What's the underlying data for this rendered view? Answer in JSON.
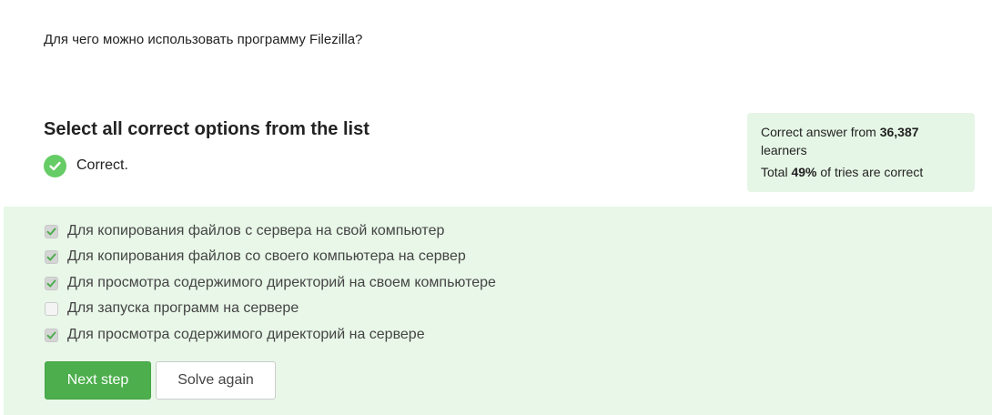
{
  "question": {
    "text": "Для чего можно использовать программу Filezilla?"
  },
  "instruction": {
    "text": "Select all correct options from the list"
  },
  "status": {
    "text": "Correct.",
    "color": "#66cc66"
  },
  "stats": {
    "prefix": "Correct answer from ",
    "learners_count": "36,387",
    "learners_suffix": " learners",
    "total_prefix": "Total ",
    "percent": "49%",
    "total_suffix": " of tries are correct"
  },
  "options": [
    {
      "label": "Для копирования файлов с сервера на свой компьютер",
      "checked": true
    },
    {
      "label": "Для копирования файлов со своего компьютера на сервер",
      "checked": true
    },
    {
      "label": "Для просмотра содержимого директорий на своем компьютере",
      "checked": true
    },
    {
      "label": "Для запуска программ на сервере",
      "checked": false
    },
    {
      "label": "Для просмотра содержимого директорий на сервере",
      "checked": true
    }
  ],
  "buttons": {
    "next": "Next step",
    "solve_again": "Solve again"
  },
  "colors": {
    "accent_green": "#4cae4c",
    "panel_bg": "#e8f7e8",
    "stats_bg": "#e6f6e6"
  }
}
